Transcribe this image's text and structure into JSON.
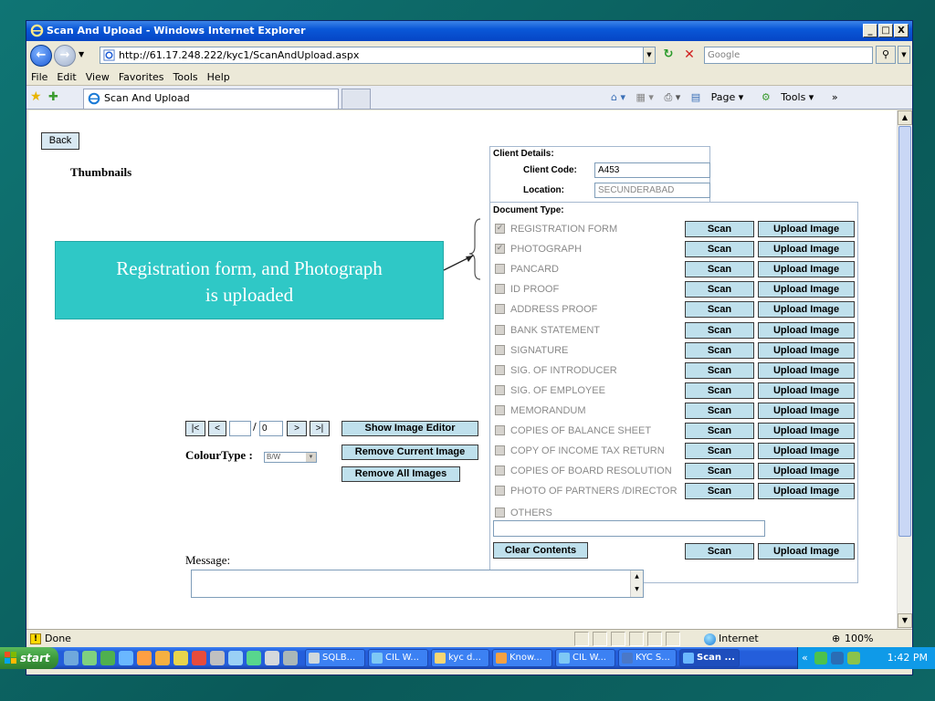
{
  "window": {
    "title": "Scan And Upload - Windows Internet Explorer",
    "minimize": "_",
    "maximize": "□",
    "close": "X"
  },
  "address": {
    "url": "http://61.17.248.222/kyc1/ScanAndUpload.aspx",
    "search_placeholder": "Google"
  },
  "menu": [
    "File",
    "Edit",
    "View",
    "Favorites",
    "Tools",
    "Help"
  ],
  "tab": {
    "label": "Scan And Upload"
  },
  "command_bar": {
    "page": "Page ▾",
    "tools": "Tools ▾"
  },
  "page": {
    "back_label": "Back",
    "thumbnails_label": "Thumbnails",
    "client": {
      "title": "Client Details:",
      "code_label": "Client Code:",
      "code_value": "A453",
      "location_label": "Location:",
      "location_value": "SECUNDERABAD"
    },
    "document_type_title": "Document Type:",
    "documents": [
      {
        "label": "REGISTRATION FORM",
        "checked": true
      },
      {
        "label": "PHOTOGRAPH",
        "checked": true
      },
      {
        "label": "PANCARD",
        "checked": false
      },
      {
        "label": "ID PROOF",
        "checked": false
      },
      {
        "label": "ADDRESS PROOF",
        "checked": false
      },
      {
        "label": "BANK STATEMENT",
        "checked": false
      },
      {
        "label": "SIGNATURE",
        "checked": false
      },
      {
        "label": "SIG. OF INTRODUCER",
        "checked": false
      },
      {
        "label": "SIG. OF EMPLOYEE",
        "checked": false
      },
      {
        "label": "MEMORANDUM",
        "checked": false
      },
      {
        "label": "COPIES OF BALANCE SHEET",
        "checked": false
      },
      {
        "label": "COPY OF INCOME TAX RETURN",
        "checked": false
      },
      {
        "label": "COPIES OF BOARD RESOLUTION",
        "checked": false
      },
      {
        "label": "PHOTO OF PARTNERS /DIRECTOR",
        "checked": false
      }
    ],
    "others_label": "OTHERS",
    "scan_label": "Scan",
    "upload_label": "Upload Image",
    "clear_label": "Clear Contents",
    "pager": {
      "first": "|<",
      "prev": "<",
      "page_value": "",
      "total_value": "0",
      "next": ">",
      "last": ">|"
    },
    "show_editor_label": "Show Image Editor",
    "remove_current_label": "Remove Current Image",
    "remove_all_label": "Remove All Images",
    "colourtype_label": "ColourType :",
    "colourtype_value": "B/W",
    "message_label": "Message:"
  },
  "annotation": {
    "text_line1": "Registration form, and Photograph",
    "text_line2": "is uploaded"
  },
  "status": {
    "text": "Done",
    "zone": "Internet",
    "zoom": "100%"
  },
  "taskbar": {
    "start_label": "start",
    "tasks": [
      "SQLB...",
      "CIL W...",
      "kyc d...",
      "Know...",
      "CIL W...",
      "KYC S...",
      "Scan ..."
    ],
    "clock": "1:42 PM"
  },
  "colors": {
    "button_fill": "#bfe0ec",
    "callout_fill": "#2fc8c6",
    "title_blue": "#0a58d8"
  }
}
